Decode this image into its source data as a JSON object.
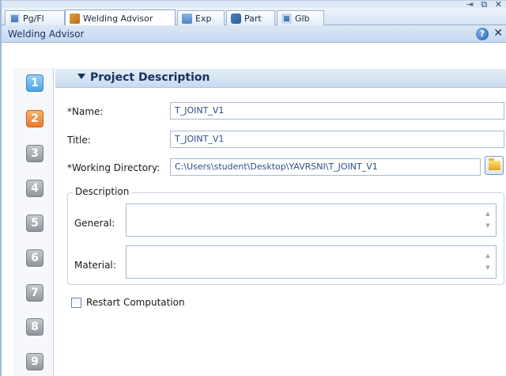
{
  "window_controls": "⇥ ⧉ ✕",
  "tabs": [
    {
      "label": "Pg/Fl",
      "icon": "grid-icon"
    },
    {
      "label": "Welding Advisor",
      "icon": "welding-tool-icon"
    },
    {
      "label": "Exp",
      "icon": "explorer-icon"
    },
    {
      "label": "Part",
      "icon": "part-icon"
    },
    {
      "label": "Glb",
      "icon": "global-icon"
    }
  ],
  "panel": {
    "title": "Welding Advisor",
    "help": "?",
    "close": "✕"
  },
  "steps": [
    "1",
    "2",
    "3",
    "4",
    "5",
    "6",
    "7",
    "8",
    "9"
  ],
  "section": {
    "title": "Project Description"
  },
  "form": {
    "name_label": "*Name:",
    "name_value": "T_JOINT_V1",
    "title_label": "Title:",
    "title_value": "T_JOINT_V1",
    "workdir_label": "*Working Directory:",
    "workdir_value": "C:\\Users\\student\\Desktop\\YAVRSNI\\T_JOINT_V1"
  },
  "description": {
    "legend": "Description",
    "general_label": "General:",
    "general_value": "",
    "material_label": "Material:",
    "material_value": ""
  },
  "restart": {
    "label": "Restart Computation",
    "checked": false
  },
  "colors": {
    "accent": "#15325e",
    "step_current": "#4aa3e6",
    "step_done": "#ea7a2a",
    "step_todo": "#8f959d"
  }
}
